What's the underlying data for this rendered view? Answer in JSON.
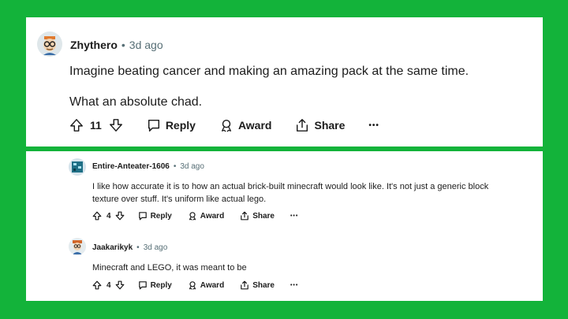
{
  "colors": {
    "background": "#13b33a",
    "card": "#ffffff",
    "meta_gray": "#576f76",
    "text": "#1c1c1c"
  },
  "main_comment": {
    "username": "Zhythero",
    "separator": "•",
    "time": "3d ago",
    "paragraphs": [
      "Imagine beating cancer and making an amazing pack at the same time.",
      "What an absolute chad."
    ],
    "votes": "11",
    "reply_label": "Reply",
    "award_label": "Award",
    "share_label": "Share",
    "more_label": "•••"
  },
  "replies": [
    {
      "username": "Entire-Anteater-1606",
      "separator": "•",
      "time": "3d ago",
      "lines": [
        "I like how accurate it is to how an actual brick-built minecraft would look like. It's not just a generic block",
        "texture over stuff. It's uniform like actual lego."
      ],
      "votes": "4",
      "reply_label": "Reply",
      "award_label": "Award",
      "share_label": "Share",
      "more_label": "•••"
    },
    {
      "username": "Jaakarikyk",
      "separator": "•",
      "time": "3d ago",
      "lines": [
        "Minecraft and LEGO, it was meant to be"
      ],
      "votes": "4",
      "reply_label": "Reply",
      "award_label": "Award",
      "share_label": "Share",
      "more_label": "•••"
    }
  ]
}
